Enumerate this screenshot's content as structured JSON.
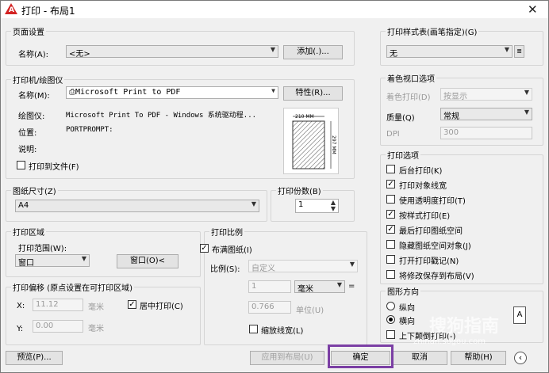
{
  "window": {
    "title": "打印 - 布局1",
    "close_glyph": "✕"
  },
  "page_setup": {
    "legend": "页面设置",
    "name_label": "名称(A):",
    "name_value": "<无>",
    "add_button": "添加(.)..."
  },
  "printer": {
    "legend": "打印机/绘图仪",
    "name_label": "名称(M):",
    "name_value": "Microsoft Print to PDF",
    "properties_button": "特性(R)...",
    "plotter_label": "绘图仪:",
    "plotter_value": "Microsoft Print To PDF - Windows 系统驱动程...",
    "location_label": "位置:",
    "location_value": "PORTPROMPT:",
    "description_label": "说明:",
    "print_to_file": "打印到文件(F)",
    "preview_width": "210 MM",
    "preview_height": "297 MM"
  },
  "paper_size": {
    "legend": "图纸尺寸(Z)",
    "value": "A4"
  },
  "copies": {
    "legend": "打印份数(B)",
    "value": "1"
  },
  "print_area": {
    "legend": "打印区域",
    "range_label": "打印范围(W):",
    "range_value": "窗口",
    "window_button": "窗口(O)<"
  },
  "print_offset": {
    "legend": "打印偏移 (原点设置在可打印区域)",
    "x_label": "X:",
    "x_value": "11.12",
    "x_unit": "毫米",
    "y_label": "Y:",
    "y_value": "0.00",
    "y_unit": "毫米",
    "center": "居中打印(C)"
  },
  "print_scale": {
    "legend": "打印比例",
    "fit": "布满图纸(I)",
    "scale_label": "比例(S):",
    "scale_value": "自定义",
    "value1": "1",
    "unit1": "毫米",
    "equals": "=",
    "value2": "0.766",
    "unit2": "单位(U)",
    "lineweights": "缩放线宽(L)"
  },
  "plot_style": {
    "legend": "打印样式表(画笔指定)(G)",
    "value": "无"
  },
  "shaded_viewport": {
    "legend": "着色视口选项",
    "shade_label": "着色打印(D)",
    "shade_value": "按显示",
    "quality_label": "质量(Q)",
    "quality_value": "常规",
    "dpi_label": "DPI",
    "dpi_value": "300"
  },
  "plot_options": {
    "legend": "打印选项",
    "items": [
      {
        "label": "后台打印(K)",
        "checked": false
      },
      {
        "label": "打印对象线宽",
        "checked": true
      },
      {
        "label": "使用透明度打印(T)",
        "checked": false
      },
      {
        "label": "按样式打印(E)",
        "checked": true
      },
      {
        "label": "最后打印图纸空间",
        "checked": true
      },
      {
        "label": "隐藏图纸空间对象(J)",
        "checked": false
      },
      {
        "label": "打开打印戳记(N)",
        "checked": false
      },
      {
        "label": "将修改保存到布局(V)",
        "checked": false
      }
    ]
  },
  "orientation": {
    "legend": "图形方向",
    "portrait": "纵向",
    "landscape": "横向",
    "upside_down": "上下颠倒打印(-)",
    "icon_letter": "A"
  },
  "footer": {
    "preview": "预览(P)...",
    "apply": "应用到布局(U)",
    "ok": "确定",
    "cancel": "取消",
    "help": "帮助(H)",
    "expand_glyph": "‹"
  },
  "watermark": {
    "text": "搜狗指南",
    "url": "zhinan.sogou.com"
  }
}
